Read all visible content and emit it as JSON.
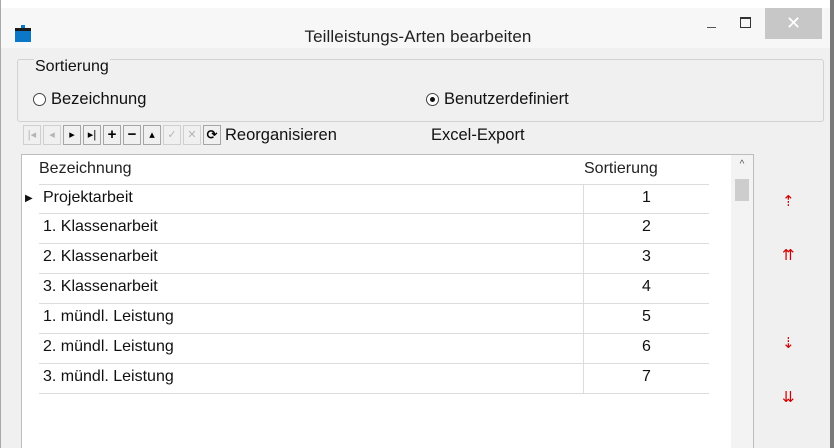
{
  "window": {
    "title": "Teilleistungs-Arten bearbeiten",
    "close_glyph": "✕"
  },
  "sort_group": {
    "label": "Sortierung",
    "options": [
      {
        "label": "Bezeichnung",
        "selected": false
      },
      {
        "label": "Benutzerdefiniert",
        "selected": true
      }
    ]
  },
  "toolbar": {
    "buttons": [
      {
        "icon": "first-record-icon",
        "glyph": "|◂",
        "enabled": false
      },
      {
        "icon": "prev-record-icon",
        "glyph": "◂",
        "enabled": false
      },
      {
        "icon": "next-record-icon",
        "glyph": "▸",
        "enabled": true
      },
      {
        "icon": "last-record-icon",
        "glyph": "▸|",
        "enabled": true
      },
      {
        "icon": "insert-icon",
        "glyph": "+",
        "enabled": true
      },
      {
        "icon": "delete-icon",
        "glyph": "−",
        "enabled": true
      },
      {
        "icon": "edit-icon",
        "glyph": "▴",
        "enabled": true
      },
      {
        "icon": "post-icon",
        "glyph": "✓",
        "enabled": false
      },
      {
        "icon": "cancel-icon",
        "glyph": "✕",
        "enabled": false
      },
      {
        "icon": "refresh-icon",
        "glyph": "⟳",
        "enabled": true
      }
    ],
    "reorganize_label": "Reorganisieren",
    "export_label": "Excel-Export"
  },
  "table": {
    "columns": [
      "Bezeichnung",
      "Sortierung"
    ],
    "current_row_marker": "▶",
    "rows": [
      {
        "name": "Projektarbeit",
        "sort": "1"
      },
      {
        "name": "1. Klassenarbeit",
        "sort": "2"
      },
      {
        "name": "2. Klassenarbeit",
        "sort": "3"
      },
      {
        "name": "3. Klassenarbeit",
        "sort": "4"
      },
      {
        "name": "1. mündl. Leistung",
        "sort": "5"
      },
      {
        "name": "2. mündl. Leistung",
        "sort": "6"
      },
      {
        "name": "3. mündl. Leistung",
        "sort": "7"
      }
    ]
  },
  "side_buttons": [
    {
      "icon": "move-up-icon",
      "glyph": "⇡"
    },
    {
      "icon": "move-to-top-icon",
      "glyph": "⇈"
    },
    {
      "icon": "move-down-icon",
      "glyph": "⇣"
    },
    {
      "icon": "move-to-bottom-icon",
      "glyph": "⇊"
    }
  ],
  "colors": {
    "arrow": "#d10000",
    "accent": "#0a77c7"
  }
}
